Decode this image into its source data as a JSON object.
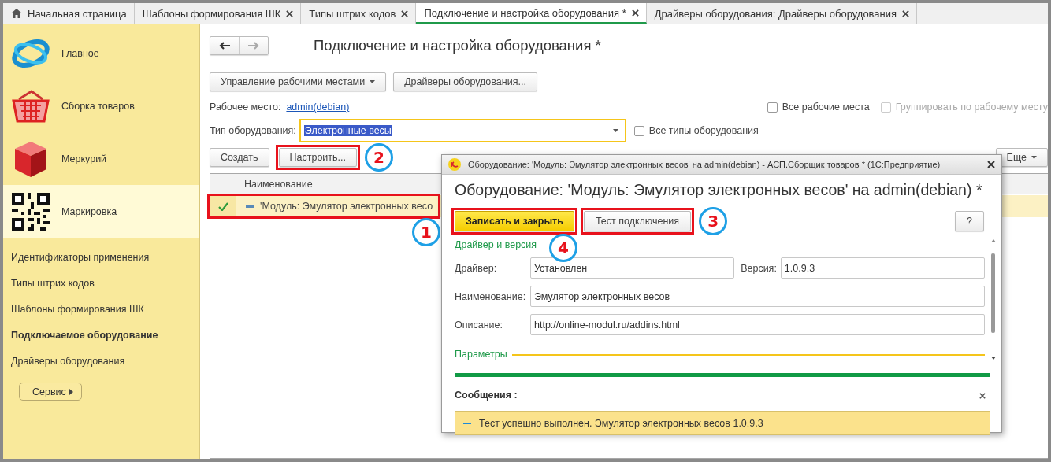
{
  "tabs": [
    {
      "label": "Начальная страница",
      "kind": "home",
      "selected": false
    },
    {
      "label": "Шаблоны формирования ШК",
      "kind": "form",
      "selected": false
    },
    {
      "label": "Типы штрих кодов",
      "kind": "form",
      "selected": false
    },
    {
      "label": "Подключение и настройка оборудования *",
      "kind": "form",
      "selected": true
    },
    {
      "label": "Драйверы оборудования: Драйверы оборудования",
      "kind": "form",
      "selected": false
    }
  ],
  "sidebar": {
    "sections": [
      {
        "label": "Главное",
        "kind": "orbit",
        "selected": false
      },
      {
        "label": "Сборка товаров",
        "kind": "basket",
        "selected": false
      },
      {
        "label": "Меркурий",
        "kind": "cube",
        "selected": false
      },
      {
        "label": "Маркировка",
        "kind": "qr",
        "selected": true
      }
    ],
    "links": [
      {
        "label": "Идентификаторы применения",
        "selected": false
      },
      {
        "label": "Типы штрих кодов",
        "selected": false
      },
      {
        "label": "Шаблоны формирования ШК",
        "selected": false
      },
      {
        "label": "Подключаемое оборудование",
        "selected": true
      },
      {
        "label": "Драйверы оборудования",
        "selected": false
      }
    ],
    "service_button": "Сервис"
  },
  "main": {
    "title": "Подключение и настройка оборудования *",
    "toolbar": [
      {
        "label": "Управление рабочими местами",
        "dropdown": true
      },
      {
        "label": "Драйверы оборудования...",
        "dropdown": false
      }
    ],
    "workplace": {
      "label": "Рабочее место:",
      "value": "admin(debian)"
    },
    "top_checkboxes": [
      {
        "label": "Все рабочие места",
        "checked": false,
        "disabled": false
      },
      {
        "label": "Группировать по рабочему месту",
        "checked": false,
        "disabled": true
      }
    ],
    "equipment_type": {
      "label": "Тип оборудования:",
      "value": "Электронные весы"
    },
    "all_types": {
      "label": "Все типы оборудования",
      "checked": false
    },
    "actions": [
      {
        "label": "Создать"
      },
      {
        "label": "Настроить...",
        "callout": "2"
      }
    ],
    "more_button": "Еще",
    "table": {
      "columns": [
        "Наименование"
      ],
      "rows": [
        {
          "name": "'Модуль: Эмулятор электронных весо",
          "enabled": true,
          "selected": true,
          "callout": "1"
        }
      ]
    }
  },
  "dialog": {
    "window_title": "Оборудование: 'Модуль: Эмулятор электронных весов' на admin(debian) - АСП.Сборщик товаров *  (1С:Предприятие)",
    "heading": "Оборудование: 'Модуль: Эмулятор электронных весов' на admin(debian) *",
    "buttons": [
      {
        "label": "Записать и закрыть",
        "kind": "primary",
        "callout": "4"
      },
      {
        "label": "Тест подключения",
        "kind": "default",
        "callout": "3"
      }
    ],
    "help_button": "?",
    "section": "Драйвер и версия",
    "field_rows": [
      [
        {
          "label": "Драйвер:",
          "value": "Установлен"
        },
        {
          "label": "Версия:",
          "value": "1.0.9.3"
        }
      ],
      [
        {
          "label": "Наименование:",
          "value": "Эмулятор электронных весов"
        }
      ],
      [
        {
          "label": "Описание:",
          "value": "http://online-modul.ru/addins.html"
        }
      ]
    ],
    "params_section": "Параметры",
    "messages": {
      "title": "Сообщения :",
      "items": [
        "Тест успешно выполнен. Эмулятор электронных весов 1.0.9.3"
      ]
    }
  }
}
